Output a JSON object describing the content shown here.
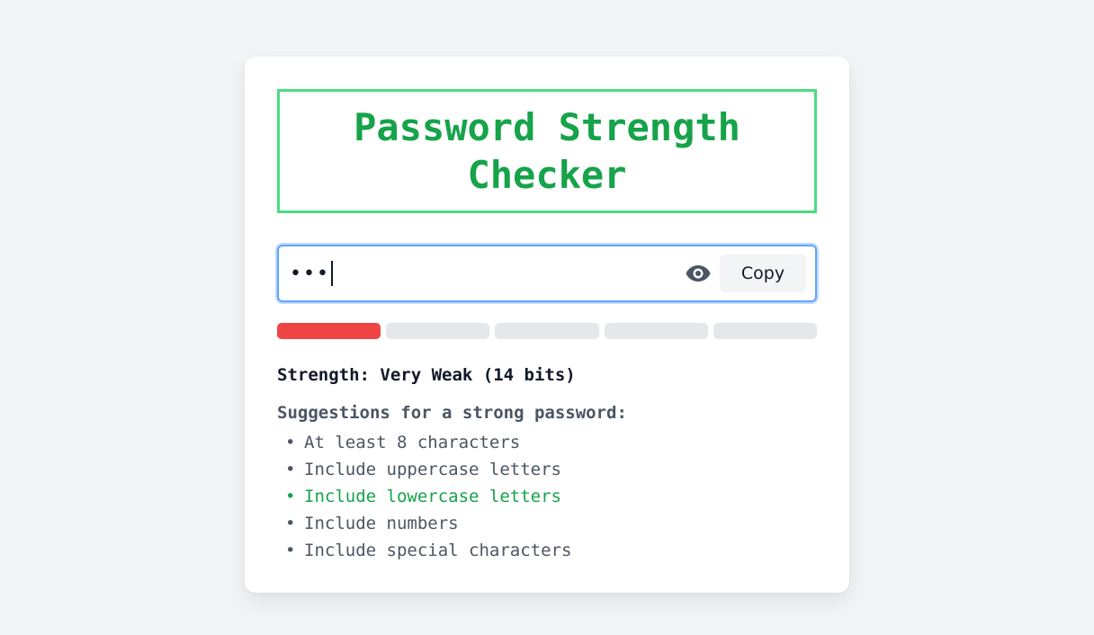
{
  "title": "Password Strength Checker",
  "password": {
    "masked_value": "•••",
    "show_toggle_icon": "eye-icon",
    "copy_label": "Copy"
  },
  "meter": {
    "segments_total": 5,
    "segments_filled": 1,
    "filled_color": "#ef4444",
    "empty_color": "#e5e7eb"
  },
  "strength_text": "Strength: Very Weak (14 bits)",
  "suggestions": {
    "title": "Suggestions for a strong password:",
    "items": [
      {
        "text": "At least 8 characters",
        "met": false
      },
      {
        "text": "Include uppercase letters",
        "met": false
      },
      {
        "text": "Include lowercase letters",
        "met": true
      },
      {
        "text": "Include numbers",
        "met": false
      },
      {
        "text": "Include special characters",
        "met": false
      }
    ]
  },
  "colors": {
    "accent_green": "#16a34a",
    "title_border": "#4ade80",
    "focus_blue": "#60a5fa",
    "weak_red": "#ef4444"
  }
}
